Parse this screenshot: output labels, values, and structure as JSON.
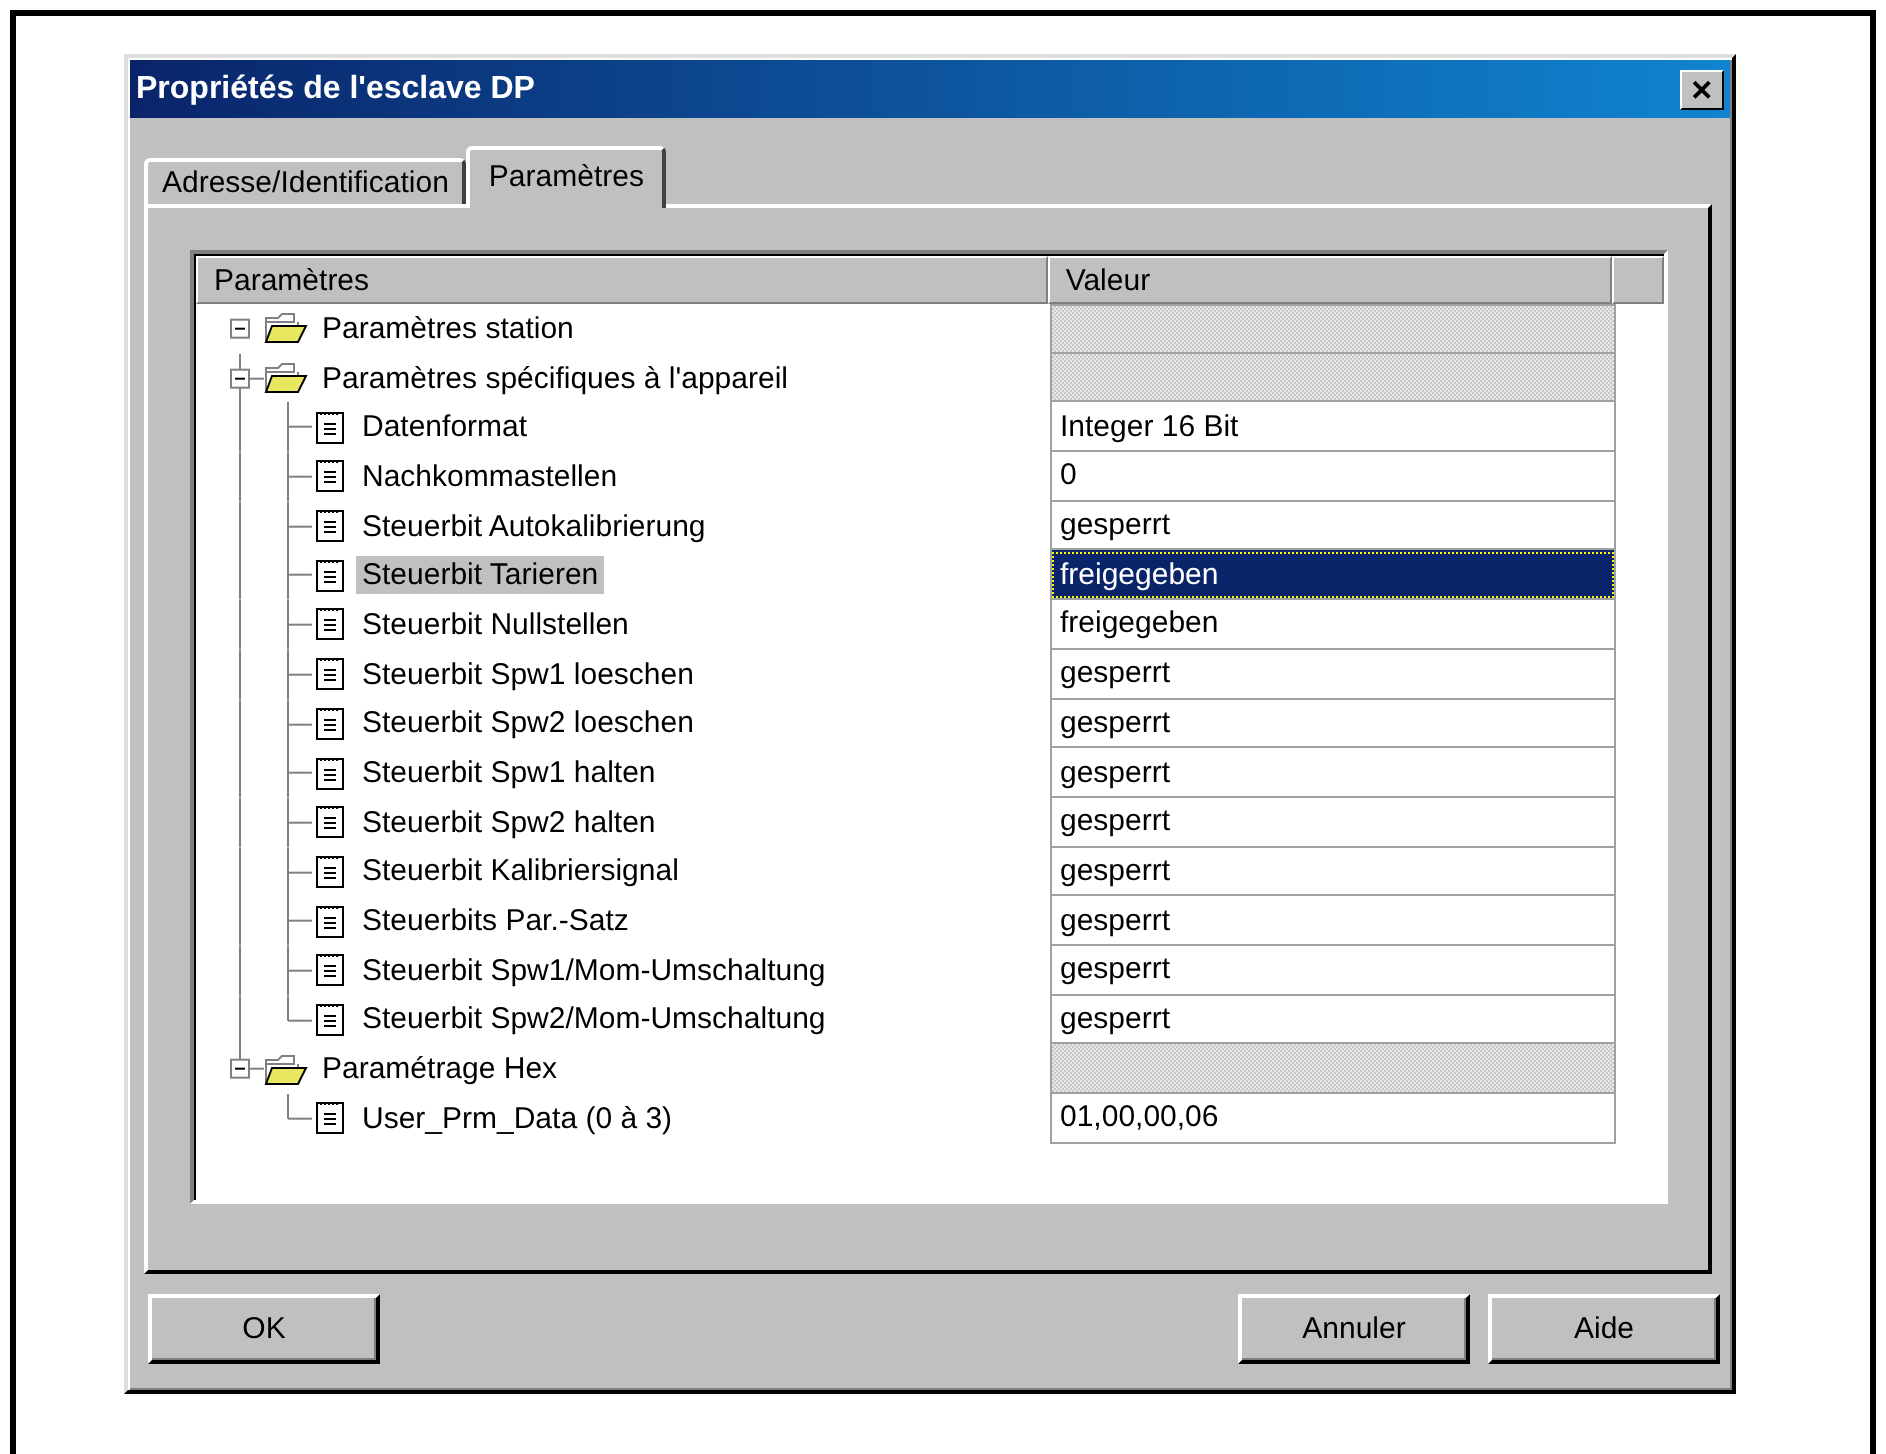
{
  "window": {
    "title": "Propriétés de l'esclave DP",
    "close": "✕"
  },
  "tabs": [
    {
      "label": "Adresse/Identification",
      "selected": false
    },
    {
      "label": "Paramètres",
      "selected": true
    }
  ],
  "table": {
    "columns": [
      "Paramètres",
      "Valeur"
    ],
    "tree": [
      {
        "kind": "folder",
        "label": "Paramètres station",
        "expanded": true,
        "selected": false,
        "children": [
          {
            "kind": "folder",
            "label": "Paramètres spécifiques à l'appareil",
            "expanded": true,
            "selected": false,
            "children": [
              {
                "kind": "item",
                "label": "Datenformat",
                "value": "Integer 16 Bit",
                "selected": false
              },
              {
                "kind": "item",
                "label": "Nachkommastellen",
                "value": "0",
                "selected": false
              },
              {
                "kind": "item",
                "label": "Steuerbit Autokalibrierung",
                "value": "gesperrt",
                "selected": false
              },
              {
                "kind": "item",
                "label": "Steuerbit Tarieren",
                "value": "freigegeben",
                "selected": true
              },
              {
                "kind": "item",
                "label": "Steuerbit Nullstellen",
                "value": "freigegeben",
                "selected": false
              },
              {
                "kind": "item",
                "label": "Steuerbit Spw1 loeschen",
                "value": "gesperrt",
                "selected": false
              },
              {
                "kind": "item",
                "label": "Steuerbit Spw2 loeschen",
                "value": "gesperrt",
                "selected": false
              },
              {
                "kind": "item",
                "label": "Steuerbit Spw1 halten",
                "value": "gesperrt",
                "selected": false
              },
              {
                "kind": "item",
                "label": "Steuerbit Spw2 halten",
                "value": "gesperrt",
                "selected": false
              },
              {
                "kind": "item",
                "label": "Steuerbit Kalibriersignal",
                "value": "gesperrt",
                "selected": false
              },
              {
                "kind": "item",
                "label": "Steuerbits Par.-Satz",
                "value": "gesperrt",
                "selected": false
              },
              {
                "kind": "item",
                "label": "Steuerbit Spw1/Mom-Umschaltung",
                "value": "gesperrt",
                "selected": false
              },
              {
                "kind": "item",
                "label": "Steuerbit Spw2/Mom-Umschaltung",
                "value": "gesperrt",
                "selected": false
              }
            ]
          },
          {
            "kind": "folder",
            "label": "Paramétrage Hex",
            "expanded": true,
            "selected": false,
            "children": [
              {
                "kind": "item",
                "label": "User_Prm_Data (0 à 3)",
                "value": "01,00,00,06",
                "selected": false
              }
            ]
          }
        ]
      }
    ]
  },
  "buttons": [
    {
      "label": "OK"
    },
    {
      "label": "Annuler"
    },
    {
      "label": "Aide"
    }
  ]
}
